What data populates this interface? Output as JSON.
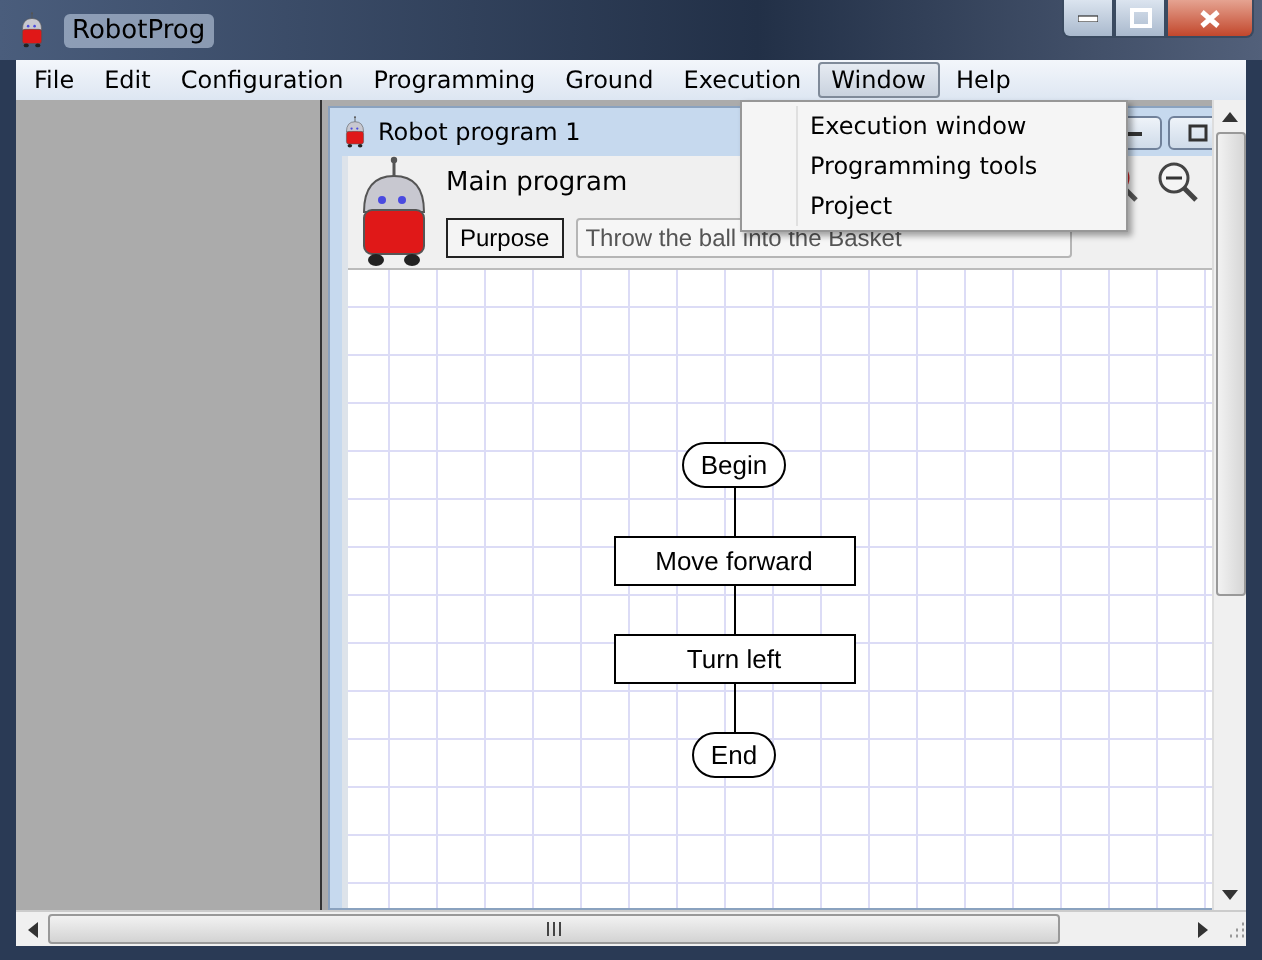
{
  "window": {
    "title": "RobotProg"
  },
  "menu": [
    {
      "label": "File",
      "selected": false
    },
    {
      "label": "Edit",
      "selected": false
    },
    {
      "label": "Configuration",
      "selected": false
    },
    {
      "label": "Programming",
      "selected": false
    },
    {
      "label": "Ground",
      "selected": false
    },
    {
      "label": "Execution",
      "selected": false
    },
    {
      "label": "Window",
      "selected": true
    },
    {
      "label": "Help",
      "selected": false
    }
  ],
  "dropdown": {
    "items": [
      "Execution window",
      "Programming tools",
      "Project"
    ]
  },
  "child_window": {
    "title": "Robot program 1"
  },
  "program": {
    "title": "Main program",
    "purpose_button": "Purpose",
    "purpose_field": "Throw the ball into the Basket"
  },
  "flowchart": {
    "nodes": [
      {
        "kind": "terminal",
        "label": "Begin"
      },
      {
        "kind": "action",
        "label": "Move forward"
      },
      {
        "kind": "action",
        "label": "Turn left"
      },
      {
        "kind": "terminal",
        "label": "End"
      }
    ]
  }
}
